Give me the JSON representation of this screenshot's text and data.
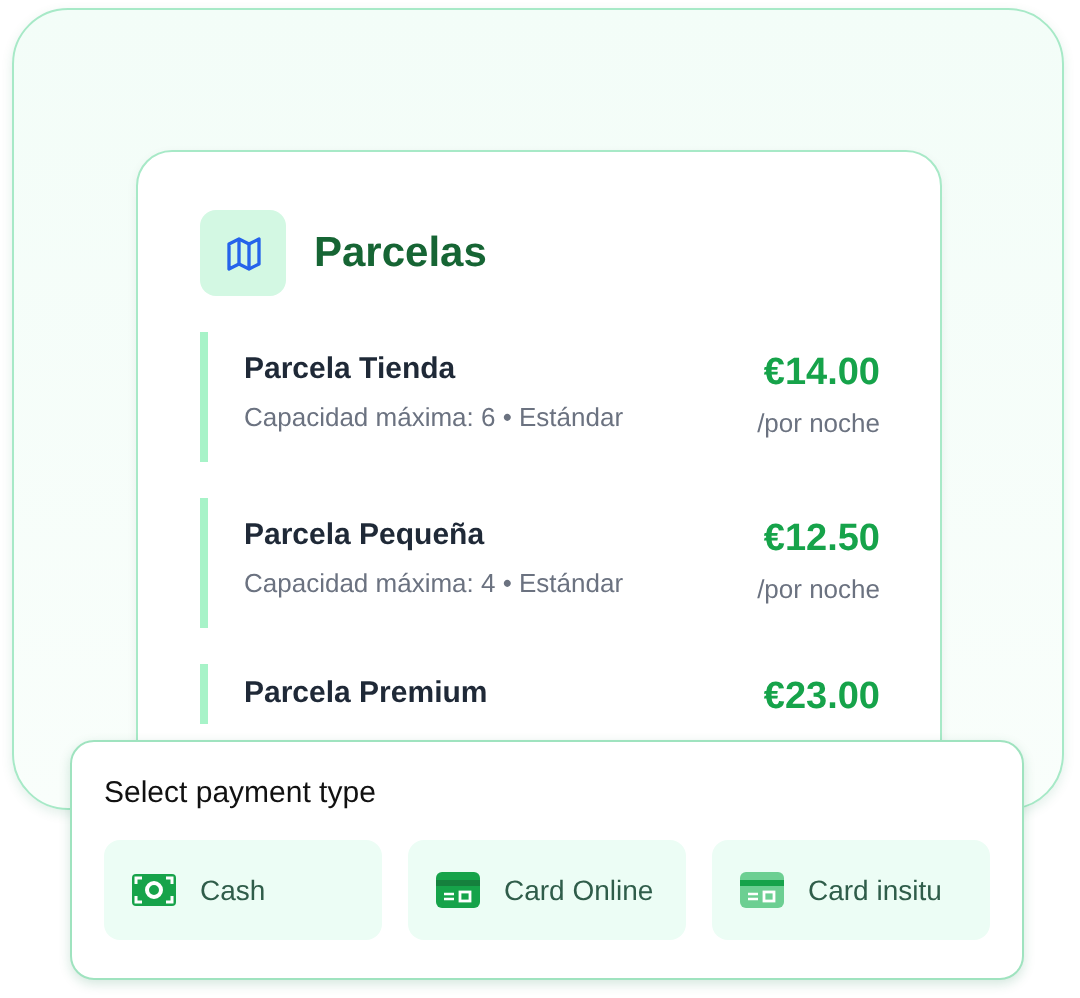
{
  "card": {
    "title": "Parcelas"
  },
  "plots": [
    {
      "name": "Parcela Tienda",
      "details": "Capacidad máxima: 6 • Estándar",
      "price": "€14.00",
      "unit": "/por noche"
    },
    {
      "name": "Parcela Pequeña",
      "details": "Capacidad máxima: 4 • Estándar",
      "price": "€12.50",
      "unit": "/por noche"
    },
    {
      "name": "Parcela Premium",
      "price": "€23.00"
    }
  ],
  "payment": {
    "title": "Select payment type",
    "options": [
      {
        "label": "Cash",
        "kind": "cash"
      },
      {
        "label": "Card Online",
        "kind": "card"
      },
      {
        "label": "Card insitu",
        "kind": "card-light"
      }
    ]
  }
}
